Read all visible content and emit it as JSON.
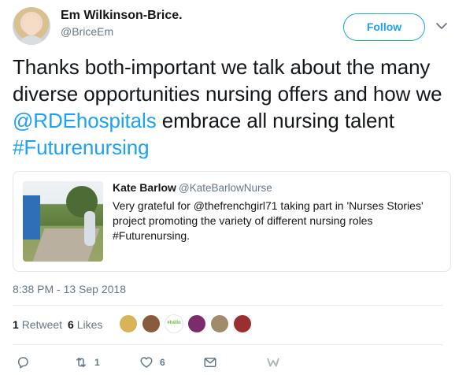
{
  "author": {
    "name": "Em Wilkinson-Brice.",
    "handle": "@BriceEm"
  },
  "follow_label": "Follow",
  "tweet": {
    "part1": "Thanks both-important we talk about the many diverse opportunities nursing offers and how we ",
    "mention": "@RDEhospitals",
    "part2": " embrace all nursing talent ",
    "hashtag": "#Futurenursing"
  },
  "quoted": {
    "name": "Kate Barlow",
    "handle": "@KateBarlowNurse",
    "text": "Very grateful for @thefrenchgirl71 taking part in 'Nurses Stories' project promoting the variety of different nursing roles #Futurenursing."
  },
  "timestamp": "8:38 PM - 13 Sep 2018",
  "stats": {
    "retweets_count": "1",
    "retweets_label": "Retweet",
    "likes_count": "6",
    "likes_label": "Likes"
  },
  "liker_avatars": [
    {
      "name": "liker-avatar-1",
      "color": "#d9b25a"
    },
    {
      "name": "liker-avatar-2",
      "color": "#8a5a3c"
    },
    {
      "name": "liker-avatar-3",
      "color": "#6bbf3a"
    },
    {
      "name": "liker-avatar-4",
      "color": "#7b2d6b"
    },
    {
      "name": "liker-avatar-5",
      "color": "#a08c6c"
    },
    {
      "name": "liker-avatar-6",
      "color": "#9b2f2f"
    }
  ],
  "liker_avatar_3_text": "#hello",
  "actions": {
    "reply_count": "",
    "retweet_count": "1",
    "like_count": "6",
    "dm_count": ""
  },
  "colors": {
    "accent": "#1da1f2",
    "text": "#14171a",
    "muted": "#657786"
  },
  "icons": [
    "chevron-down-icon",
    "reply-icon",
    "retweet-icon",
    "heart-icon",
    "envelope-icon",
    "moments-w-icon"
  ]
}
